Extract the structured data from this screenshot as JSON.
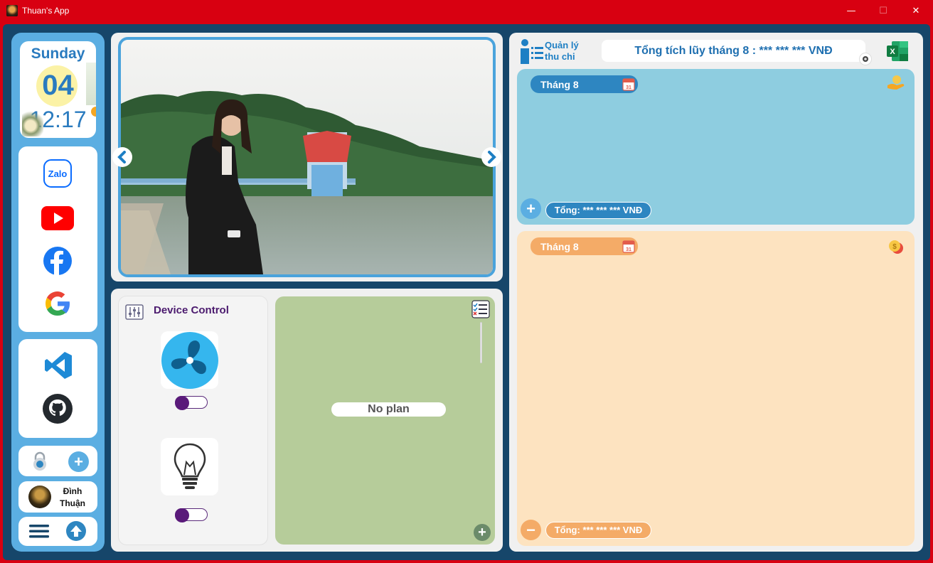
{
  "window": {
    "title": "Thuan's App",
    "minimize": "—",
    "maximize": "☐",
    "close": "✕"
  },
  "clock": {
    "day": "Sunday",
    "date": "04",
    "time": "12:17"
  },
  "apps": [
    {
      "name": "zalo",
      "label": "Zalo"
    },
    {
      "name": "youtube"
    },
    {
      "name": "facebook"
    },
    {
      "name": "google"
    },
    {
      "name": "vscode"
    },
    {
      "name": "github"
    }
  ],
  "user": {
    "name_line1": "Đình",
    "name_line2": "Thuận"
  },
  "device_control": {
    "title": "Device Control",
    "devices": [
      {
        "name": "fan",
        "state": "off"
      },
      {
        "name": "light-bulb",
        "state": "off"
      }
    ]
  },
  "plan": {
    "empty_text": "No plan"
  },
  "finance": {
    "logo_line1": "Quản lý",
    "logo_line2": "thu chi",
    "summary": "Tổng tích lũy tháng 8 : *** *** *** VNĐ",
    "income": {
      "month": "Tháng 8",
      "total": "Tổng: *** *** *** VNĐ",
      "color": "#8ecde0",
      "accent": "#2e86c1"
    },
    "expense": {
      "month": "Tháng 8",
      "total": "Tổng: *** *** *** VNĐ",
      "color": "#fde3c0",
      "accent": "#f4ab67"
    }
  },
  "colors": {
    "titlebar": "#d80011",
    "frame": "#16466a",
    "sidebar": "#5baee2",
    "plan_bg": "#b6cc9a"
  }
}
